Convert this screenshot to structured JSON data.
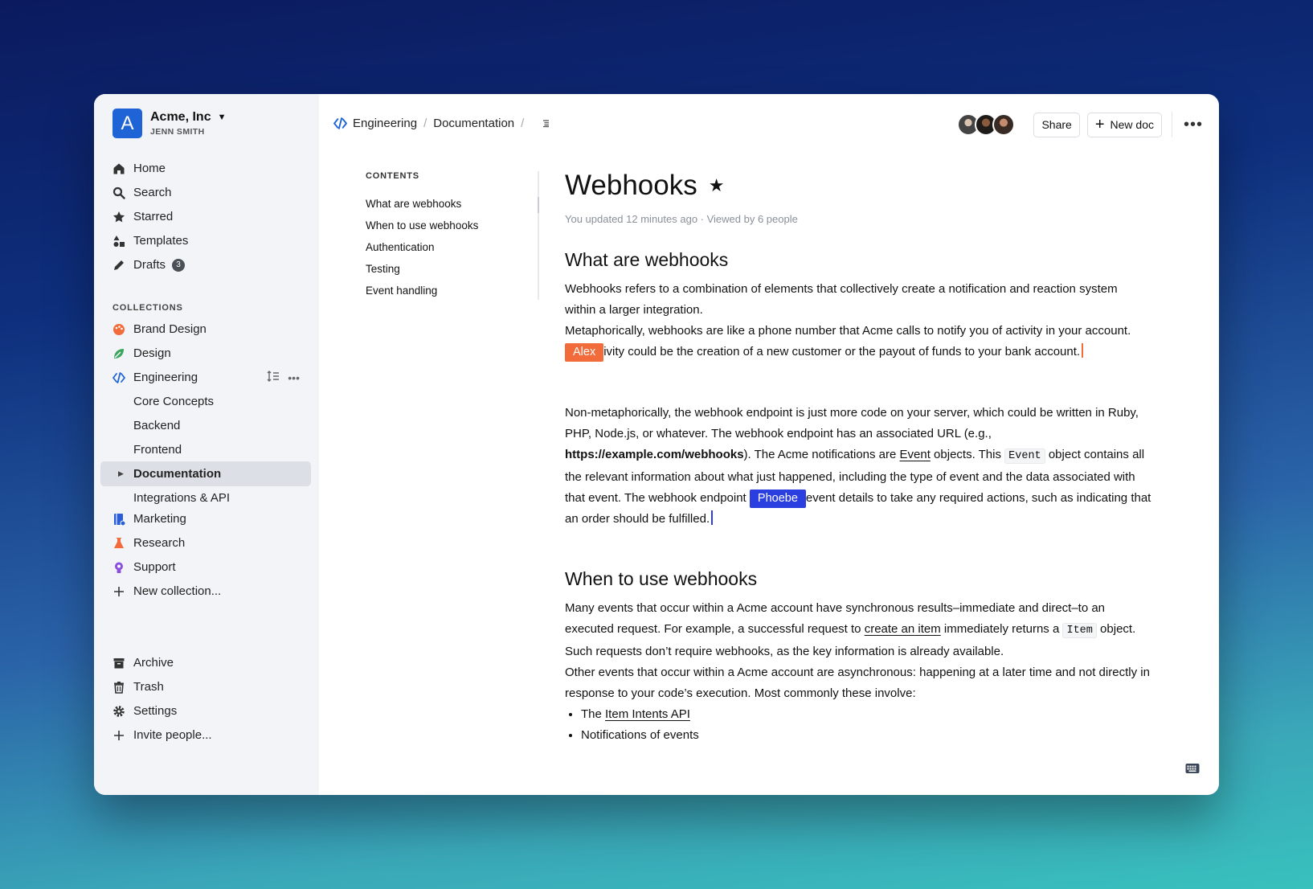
{
  "team": {
    "logo_letter": "A",
    "name": "Acme, Inc",
    "user": "JENN SMITH"
  },
  "nav": {
    "home": "Home",
    "search": "Search",
    "starred": "Starred",
    "templates": "Templates",
    "drafts": "Drafts",
    "drafts_count": "3"
  },
  "collections": {
    "label": "COLLECTIONS",
    "items": [
      {
        "label": "Brand Design",
        "icon": "palette-icon",
        "color": "#f26b3a"
      },
      {
        "label": "Design",
        "icon": "leaf-icon",
        "color": "#3aa55c"
      },
      {
        "label": "Engineering",
        "icon": "code-icon",
        "color": "#1f64d6"
      },
      {
        "label": "Core Concepts"
      },
      {
        "label": "Backend"
      },
      {
        "label": "Frontend"
      },
      {
        "label": "Documentation"
      },
      {
        "label": "Integrations & API"
      },
      {
        "label": "Marketing",
        "icon": "book-icon",
        "color": "#2a5fd6"
      },
      {
        "label": "Research",
        "icon": "flask-icon",
        "color": "#f26b3a"
      },
      {
        "label": "Support",
        "icon": "lightbulb-icon",
        "color": "#8b4fe0"
      }
    ],
    "new_collection": "New collection..."
  },
  "footer_nav": {
    "archive": "Archive",
    "trash": "Trash",
    "settings": "Settings",
    "invite": "Invite people..."
  },
  "breadcrumb": {
    "collection": "Engineering",
    "doc": "Documentation"
  },
  "header": {
    "share": "Share",
    "new_doc": "New doc"
  },
  "contents": {
    "label": "CONTENTS",
    "items": [
      "What are webhooks",
      "When to use webhooks",
      "Authentication",
      "Testing",
      "Event handling"
    ]
  },
  "doc": {
    "title": "Webhooks",
    "meta": "You updated 12 minutes ago · Viewed by 6 people",
    "h1": "What are webhooks",
    "p1": "Webhooks refers to a combination of elements that collectively create a notification and reaction system within a larger integration.",
    "p2a": "Metaphorically, webhooks are like a phone number that Acme calls to notify you of activity in your account.",
    "p2b": "ivity could be the creation of a new customer or the payout of funds to your bank account.",
    "cursor_alex": "Alex",
    "cursor_alex_color": "#f26b3a",
    "p3a": "Non-metaphorically, the webhook endpoint is just more code on your server, which could be written in Ruby, PHP, Node.js, or whatever. The webhook endpoint has an associated URL (e.g., ",
    "p3_url": "https://example.com/webhooks",
    "p3b": "). The Acme notifications are ",
    "p3_event_link": "Event",
    "p3c": " objects. This ",
    "p3_code": "Event",
    "p3d": " object contains all the relevant information about what just happened, including the type of event and the data associated with that event. The webhook endpoint ",
    "cursor_phoebe": "Phoebe",
    "cursor_phoebe_color": "#2b3fe0",
    "p3e": "event details to take any required actions, such as indicating that an order should be fulfilled.",
    "h2": "When to use webhooks",
    "p4a": "Many events that occur within a Acme account have synchronous results–immediate and direct–to an executed request. For example, a successful request to ",
    "p4_link": "create an item",
    "p4b": " immediately returns a ",
    "p4_code": "Item",
    "p4c": " object. Such requests don’t require webhooks, as the key information is already available.",
    "p5": "Other events that occur within a Acme account are asynchronous: happening at a later time and not directly in response to your code’s execution. Most commonly these involve:",
    "li1a": "The ",
    "li1_link": "Item Intents API",
    "li2": "Notifications of events"
  }
}
